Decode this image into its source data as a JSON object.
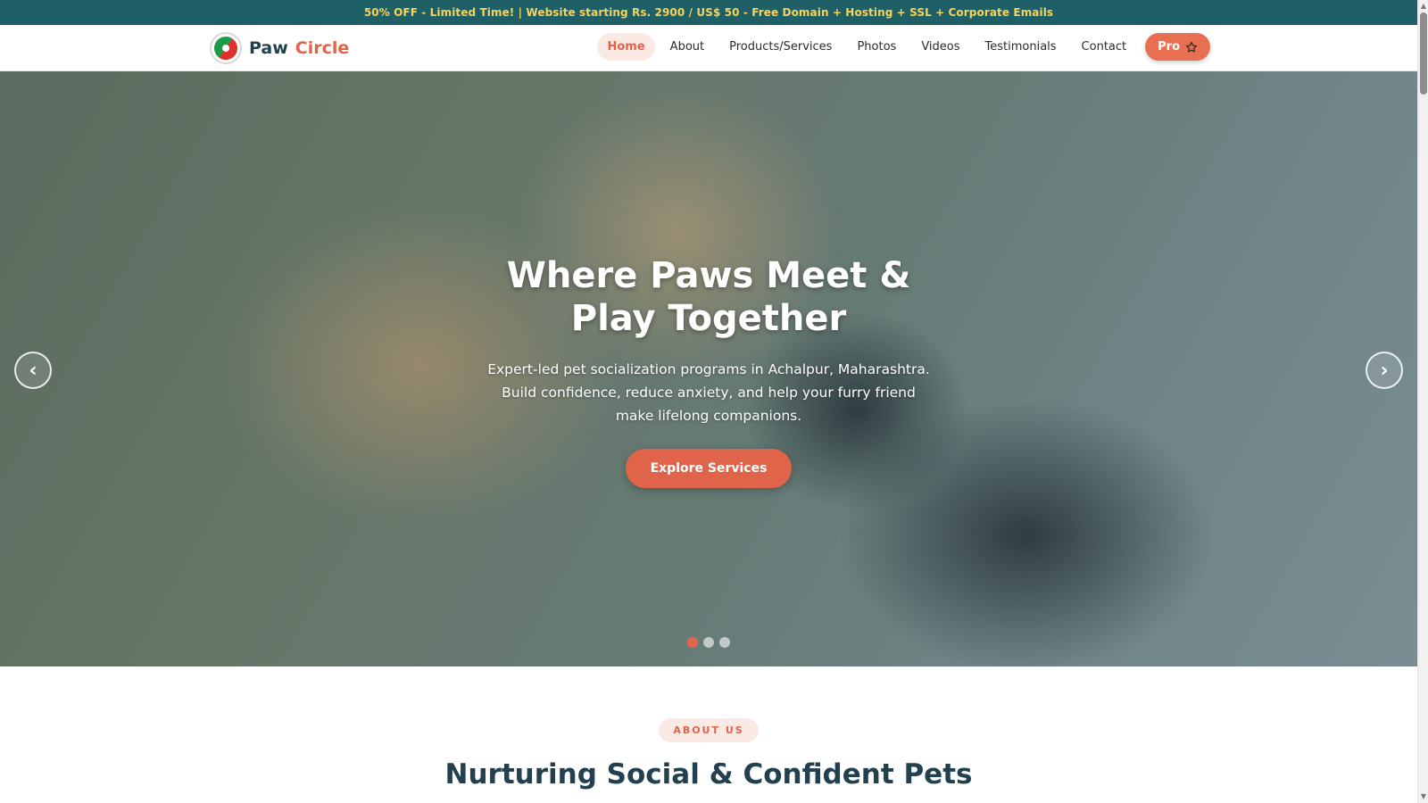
{
  "promo": {
    "text": "50% OFF - Limited Time! | Website starting Rs. 2900 / US$ 50 - Free Domain + Hosting + SSL + Corporate Emails"
  },
  "brand": {
    "name_part1": "Paw",
    "name_part2": "Circle",
    "logo_icon": "yin-yang-logo-icon"
  },
  "nav": {
    "items": [
      {
        "label": "Home",
        "active": true
      },
      {
        "label": "About"
      },
      {
        "label": "Products/Services"
      },
      {
        "label": "Photos"
      },
      {
        "label": "Videos"
      },
      {
        "label": "Testimonials"
      },
      {
        "label": "Contact"
      }
    ],
    "pro_label": "Pro",
    "pro_icon": "star-icon"
  },
  "hero": {
    "title": "Where Paws Meet & Play Together",
    "subtitle": "Expert-led pet socialization programs in Achalpur, Maharashtra. Build confidence, reduce anxiety, and help your furry friend make lifelong companions.",
    "cta_label": "Explore Services",
    "prev_arrow": "‹",
    "next_arrow": "›",
    "slide_count": 3,
    "active_slide": 1
  },
  "about": {
    "badge": "ABOUT US",
    "title": "Nurturing Social & Confident Pets"
  },
  "colors": {
    "promo_bg": "#1f5f66",
    "promo_text": "#f4d35e",
    "accent": "#e0644a",
    "heading": "#22404f"
  }
}
